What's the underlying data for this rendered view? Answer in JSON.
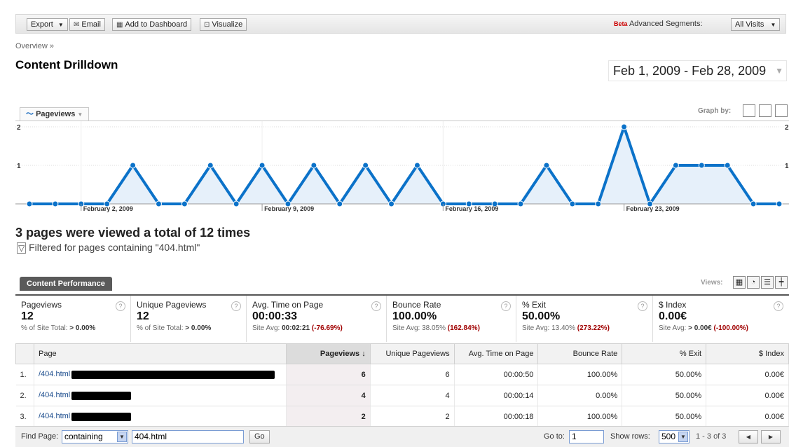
{
  "toolbar": {
    "export_label": "Export",
    "email_label": "Email",
    "add_dashboard_label": "Add to Dashboard",
    "visualize_label": "Visualize",
    "beta_label": "Beta",
    "segments_label": "Advanced Segments:",
    "segments_value": "All Visits"
  },
  "breadcrumb": "Overview »",
  "page_title": "Content Drilldown",
  "date_range": "Feb 1, 2009 - Feb 28, 2009",
  "graph": {
    "metric_label": "Pageviews",
    "graph_by_label": "Graph by:"
  },
  "chart_data": {
    "type": "area",
    "title": "",
    "series": [
      {
        "name": "Pageviews",
        "values": [
          0,
          0,
          0,
          0,
          1,
          0,
          0,
          1,
          0,
          1,
          0,
          1,
          0,
          1,
          0,
          1,
          0,
          0,
          0,
          0,
          1,
          0,
          0,
          2,
          0,
          1,
          1,
          1,
          0,
          0
        ]
      }
    ],
    "ylim": [
      0,
      2
    ],
    "yticks": [
      "1",
      "2"
    ],
    "xticks": [
      {
        "label": "February 2, 2009",
        "index": 2
      },
      {
        "label": "February 9, 2009",
        "index": 9
      },
      {
        "label": "February 16, 2009",
        "index": 16
      },
      {
        "label": "February 23, 2009",
        "index": 23
      }
    ],
    "color": "#0b72c9",
    "fill": "#e6f0fa",
    "grid": true
  },
  "summary": {
    "headline": "3 pages were viewed a total of 12 times",
    "filter_text": "Filtered for pages containing \"404.html\""
  },
  "performance": {
    "tab_label": "Content Performance",
    "views_label": "Views:"
  },
  "scorecard": [
    {
      "label": "Pageviews",
      "value": "12",
      "sub_prefix": "% of Site Total: ",
      "sub_bold": "> 0.00%",
      "sub_neg": ""
    },
    {
      "label": "Unique Pageviews",
      "value": "12",
      "sub_prefix": "% of Site Total: ",
      "sub_bold": "> 0.00%",
      "sub_neg": ""
    },
    {
      "label": "Avg. Time on Page",
      "value": "00:00:33",
      "sub_prefix": "Site Avg: ",
      "sub_bold": "00:02:21",
      "sub_neg": "(-76.69%)"
    },
    {
      "label": "Bounce Rate",
      "value": "100.00%",
      "sub_prefix": "Site Avg: 38.05% ",
      "sub_bold": "",
      "sub_neg": "(162.84%)"
    },
    {
      "label": "% Exit",
      "value": "50.00%",
      "sub_prefix": "Site Avg: 13.40% ",
      "sub_bold": "",
      "sub_neg": "(273.22%)"
    },
    {
      "label": "$ Index",
      "value": "0.00€",
      "sub_prefix": "Site Avg: ",
      "sub_bold": "> 0.00€",
      "sub_neg": "(-100.00%)"
    }
  ],
  "table": {
    "headers": {
      "page": "Page",
      "pageviews": "Pageviews",
      "unique": "Unique Pageviews",
      "avg_time": "Avg. Time on Page",
      "bounce": "Bounce Rate",
      "exit": "% Exit",
      "index": "$ Index"
    },
    "rows": [
      {
        "num": "1.",
        "page": "/404.html",
        "pageviews": "6",
        "unique": "6",
        "avg_time": "00:00:50",
        "bounce": "100.00%",
        "exit": "50.00%",
        "index": "0.00€"
      },
      {
        "num": "2.",
        "page": "/404.html",
        "pageviews": "4",
        "unique": "4",
        "avg_time": "00:00:14",
        "bounce": "0.00%",
        "exit": "50.00%",
        "index": "0.00€"
      },
      {
        "num": "3.",
        "page": "/404.html",
        "pageviews": "2",
        "unique": "2",
        "avg_time": "00:00:18",
        "bounce": "100.00%",
        "exit": "50.00%",
        "index": "0.00€"
      }
    ]
  },
  "footer": {
    "find_page_label": "Find Page:",
    "match_type": "containing",
    "search_value": "404.html",
    "go_label": "Go",
    "goto_label": "Go to:",
    "goto_value": "1",
    "show_rows_label": "Show rows:",
    "rows_value": "500",
    "range_text": "1 - 3 of 3"
  }
}
